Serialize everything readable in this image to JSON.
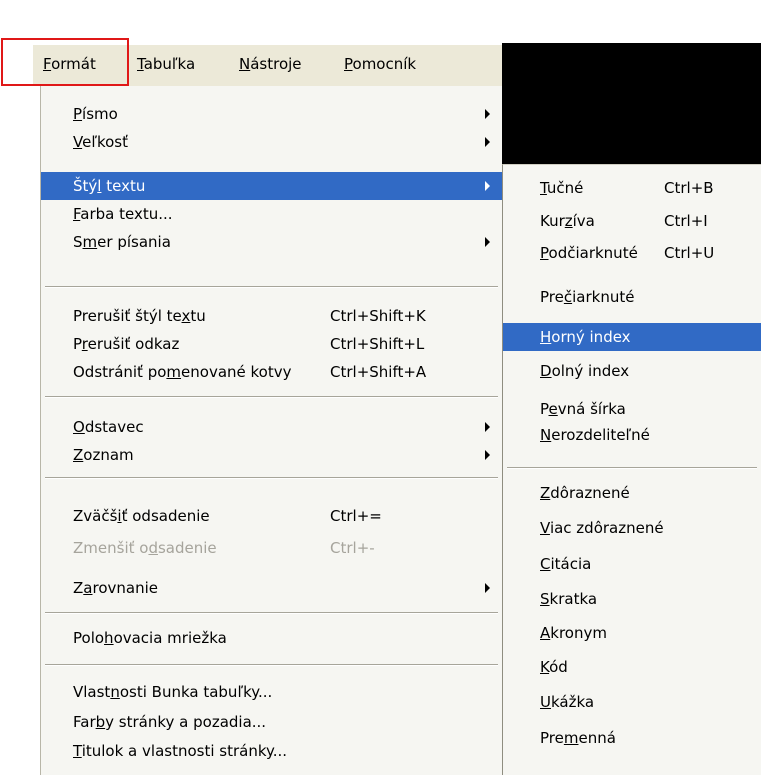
{
  "menubar": {
    "items": [
      {
        "pre": "",
        "u": "F",
        "post": "ormát"
      },
      {
        "pre": "",
        "u": "T",
        "post": "abuľka"
      },
      {
        "pre": "",
        "u": "N",
        "post": "ástroje"
      },
      {
        "pre": "",
        "u": "P",
        "post": "omocník"
      }
    ]
  },
  "format_menu": {
    "items": [
      {
        "pre": "",
        "u": "P",
        "post": "ísmo",
        "shortcut": "",
        "submenu": true
      },
      {
        "pre": "",
        "u": "V",
        "post": "eľkosť",
        "shortcut": "",
        "submenu": true
      },
      {
        "pre": "Štý",
        "u": "l",
        "post": " textu",
        "shortcut": "",
        "submenu": true
      },
      {
        "pre": "",
        "u": "F",
        "post": "arba textu...",
        "shortcut": "",
        "submenu": false
      },
      {
        "pre": "S",
        "u": "m",
        "post": "er písania",
        "shortcut": "",
        "submenu": true
      },
      {
        "pre": "Prerušiť štýl te",
        "u": "x",
        "post": "tu",
        "shortcut": "Ctrl+Shift+K",
        "submenu": false
      },
      {
        "pre": "P",
        "u": "r",
        "post": "erušiť odkaz",
        "shortcut": "Ctrl+Shift+L",
        "submenu": false
      },
      {
        "pre": "Odstrániť po",
        "u": "m",
        "post": "enované kotvy",
        "shortcut": "Ctrl+Shift+A",
        "submenu": false
      },
      {
        "pre": "",
        "u": "O",
        "post": "dstavec",
        "shortcut": "",
        "submenu": true
      },
      {
        "pre": "",
        "u": "Z",
        "post": "oznam",
        "shortcut": "",
        "submenu": true
      },
      {
        "pre": "Zväčš",
        "u": "i",
        "post": "ť odsadenie",
        "shortcut": "Ctrl+=",
        "submenu": false
      },
      {
        "pre": "Zmenšiť o",
        "u": "d",
        "post": "sadenie",
        "shortcut": "Ctrl+-",
        "submenu": false
      },
      {
        "pre": "Z",
        "u": "a",
        "post": "rovnanie",
        "shortcut": "",
        "submenu": true
      },
      {
        "pre": "Polo",
        "u": "h",
        "post": "ovacia mriežka",
        "shortcut": "",
        "submenu": false
      },
      {
        "pre": "Vlast",
        "u": "n",
        "post": "osti Bunka tabuľky...",
        "shortcut": "",
        "submenu": false
      },
      {
        "pre": "Far",
        "u": "b",
        "post": "y stránky a pozadia...",
        "shortcut": "",
        "submenu": false
      },
      {
        "pre": "",
        "u": "T",
        "post": "itulok a vlastnosti stránky...",
        "shortcut": "",
        "submenu": false
      }
    ]
  },
  "text_style_submenu": {
    "items": [
      {
        "pre": "",
        "u": "T",
        "post": "učné",
        "shortcut": "Ctrl+B"
      },
      {
        "pre": "Kur",
        "u": "z",
        "post": "íva",
        "shortcut": "Ctrl+I"
      },
      {
        "pre": "",
        "u": "P",
        "post": "odčiarknuté",
        "shortcut": "Ctrl+U"
      },
      {
        "pre": "Pre",
        "u": "č",
        "post": "iarknuté",
        "shortcut": ""
      },
      {
        "pre": "",
        "u": "H",
        "post": "orný index",
        "shortcut": ""
      },
      {
        "pre": "",
        "u": "D",
        "post": "olný index",
        "shortcut": ""
      },
      {
        "pre": "P",
        "u": "e",
        "post": "vná šírka",
        "shortcut": ""
      },
      {
        "pre": "",
        "u": "N",
        "post": "erozdeliteľné",
        "shortcut": ""
      },
      {
        "pre": "",
        "u": "Z",
        "post": "dôraznené",
        "shortcut": ""
      },
      {
        "pre": "",
        "u": "V",
        "post": "iac zdôraznené",
        "shortcut": ""
      },
      {
        "pre": "",
        "u": "C",
        "post": "itácia",
        "shortcut": ""
      },
      {
        "pre": "",
        "u": "S",
        "post": "kratka",
        "shortcut": ""
      },
      {
        "pre": "",
        "u": "A",
        "post": "kronym",
        "shortcut": ""
      },
      {
        "pre": "",
        "u": "K",
        "post": "ód",
        "shortcut": ""
      },
      {
        "pre": "",
        "u": "U",
        "post": "kážka",
        "shortcut": ""
      },
      {
        "pre": "Pre",
        "u": "m",
        "post": "enná",
        "shortcut": ""
      }
    ]
  },
  "colors": {
    "highlight": "#316ac5",
    "menu_background": "#f6f6f2",
    "menubar_background": "#ece9d8",
    "annotation_box": "#e01818",
    "disabled_text": "#a6a49c"
  }
}
